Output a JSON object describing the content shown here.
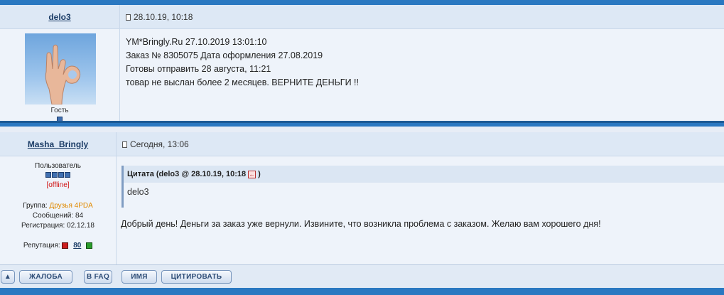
{
  "post1": {
    "author": "delo3",
    "date": "28.10.19, 10:18",
    "status": "Гость",
    "lines": [
      "YM*Bringly.Ru 27.10.2019 13:01:10",
      "Заказ № 8305075 Дата оформления 27.08.2019",
      "Готовы отправить 28 августа, 11:21",
      "товар не выслан более 2 месяцев. ВЕРНИТЕ ДЕНЬГИ  !!"
    ]
  },
  "post2": {
    "author": "Masha_Bringly",
    "date": "Сегодня, 13:06",
    "role": "Пользователь",
    "online_status": "[offline]",
    "group_label": "Группа:",
    "group_value": "Друзья 4PDA",
    "posts_label": "Сообщений:",
    "posts_value": "84",
    "reg_label": "Регистрация:",
    "reg_value": "02.12.18",
    "rep_label": "Репутация:",
    "rep_value": "80",
    "quote_head": "Цитата (delo3 @ 28.10.19, 10:18",
    "quote_head_close": ")",
    "quote_text": "delo3",
    "message": "Добрый день! Деньги за заказ уже вернули. Извините, что возникла проблема с заказом. Желаю вам хорошего дня!"
  },
  "buttons": {
    "up": "▲",
    "report": "ЖАЛОБА",
    "faq": "В FAQ",
    "name": "ИМЯ",
    "quote": "ЦИТИРОВАТЬ"
  },
  "colors": {
    "brand": "#2a78c1",
    "header_bg": "#dde8f5",
    "body_bg": "#eef3fa",
    "offline": "#d01010",
    "group": "#e08a00"
  }
}
